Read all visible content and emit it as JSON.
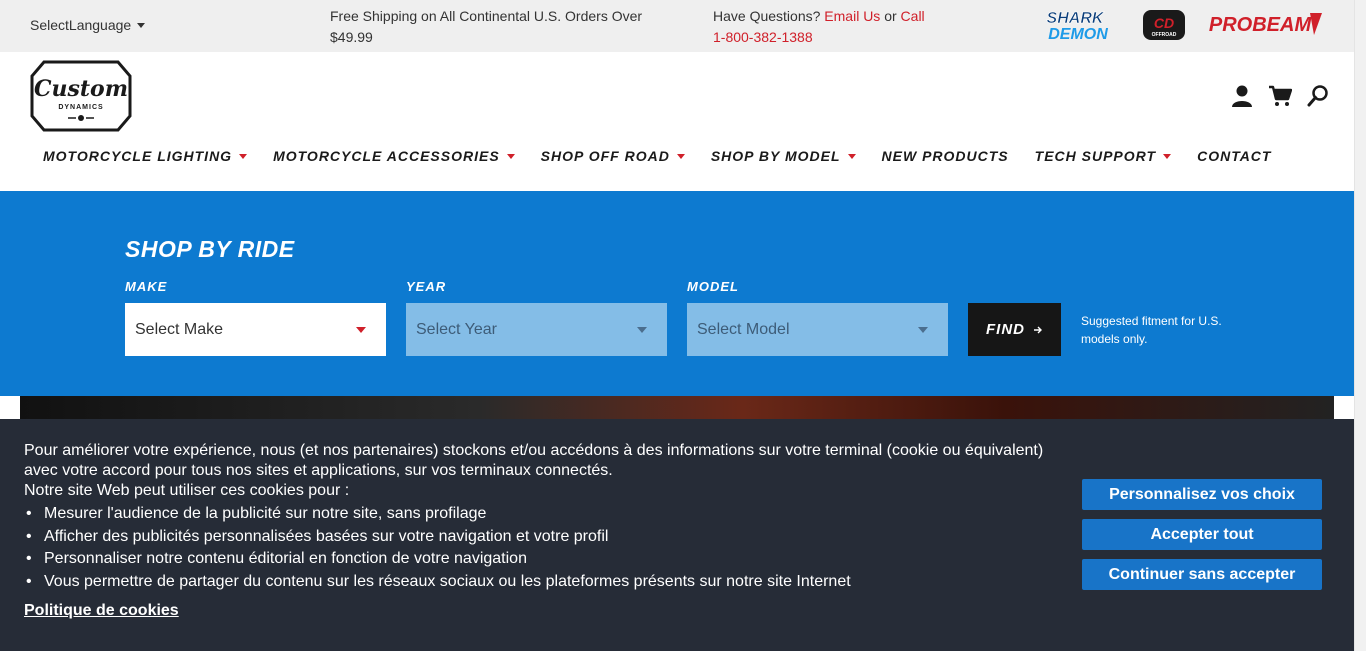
{
  "topbar": {
    "language_label": "SelectLanguage",
    "shipping_text": "Free Shipping on All Continental U.S. Orders Over $49.99",
    "questions_prefix": "Have Questions?",
    "email_link": "Email Us",
    "or_text": "or",
    "call_link": "Call",
    "phone": "1-800-382-1388",
    "brand_logos": [
      "SHARK DEMON",
      "CD OFFROAD",
      "PROBEAM"
    ]
  },
  "header": {
    "logo_main": "Custom",
    "logo_sub": "DYNAMICS",
    "icons": [
      "account-icon",
      "cart-icon",
      "search-icon"
    ]
  },
  "nav": {
    "items": [
      {
        "label": "MOTORCYCLE LIGHTING",
        "has_dropdown": true
      },
      {
        "label": "MOTORCYCLE ACCESSORIES",
        "has_dropdown": true
      },
      {
        "label": "SHOP OFF ROAD",
        "has_dropdown": true
      },
      {
        "label": "SHOP BY MODEL",
        "has_dropdown": true
      },
      {
        "label": "NEW PRODUCTS",
        "has_dropdown": false
      },
      {
        "label": "TECH SUPPORT",
        "has_dropdown": true
      },
      {
        "label": "CONTACT",
        "has_dropdown": false
      }
    ]
  },
  "shop_by_ride": {
    "title": "SHOP BY RIDE",
    "make_label": "MAKE",
    "make_value": "Select Make",
    "year_label": "YEAR",
    "year_value": "Select Year",
    "model_label": "MODEL",
    "model_value": "Select Model",
    "find_label": "FIND",
    "fitment_note": "Suggested fitment for U.S. models only."
  },
  "cookie": {
    "intro_1": "Pour améliorer votre expérience, nous (et nos partenaires) stockons et/ou accédons à des informations sur votre terminal (cookie ou équivalent) avec votre accord pour tous nos sites et applications, sur vos terminaux connectés.",
    "intro_2": "Notre site Web peut utiliser ces cookies pour :",
    "bullets": [
      "Mesurer l'audience de la publicité sur notre site, sans profilage",
      "Afficher des publicités personnalisées basées sur votre navigation et votre profil",
      "Personnaliser notre contenu éditorial en fonction de votre navigation",
      "Vous permettre de partager du contenu sur les réseaux sociaux ou les plateformes présents sur notre site Internet"
    ],
    "policy_link": "Politique de cookies",
    "btn_customize": "Personnalisez vos choix",
    "btn_accept": "Accepter tout",
    "btn_continue": "Continuer sans accepter"
  },
  "colors": {
    "accent_red": "#d0202a",
    "ride_blue": "#0d7ad0",
    "cookie_bg": "#262c37",
    "cookie_button": "#1874c8"
  }
}
